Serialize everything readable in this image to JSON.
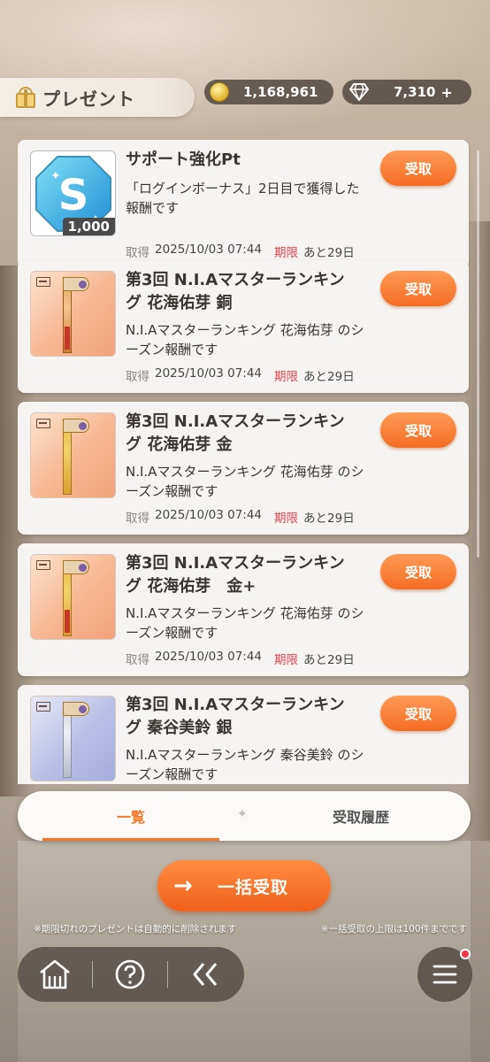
{
  "header": {
    "title": "プレゼント",
    "coins": "1,168,961",
    "gems": "7,310",
    "gems_plus": "+"
  },
  "items": [
    {
      "title": "サポート強化Pt",
      "desc": "「ログインボーナス」2日目で獲得した報酬です",
      "qty": "1,000",
      "acquired_label": "取得",
      "acquired": "2025/10/03 07:44",
      "limit_label": "期限",
      "remaining": "あと29日",
      "button": "受取",
      "thumb": "support-pt"
    },
    {
      "title": "第3回 N.I.Aマスターランキング 花海佑芽 銅",
      "desc": "N.I.Aマスターランキング 花海佑芽 のシーズン報酬です",
      "acquired_label": "取得",
      "acquired": "2025/10/03 07:44",
      "limit_label": "期限",
      "remaining": "あと29日",
      "button": "受取",
      "thumb": "banner-copper"
    },
    {
      "title": "第3回 N.I.Aマスターランキング 花海佑芽 金",
      "desc": "N.I.Aマスターランキング 花海佑芽 のシーズン報酬です",
      "acquired_label": "取得",
      "acquired": "2025/10/03 07:44",
      "limit_label": "期限",
      "remaining": "あと29日",
      "button": "受取",
      "thumb": "banner-gold"
    },
    {
      "title": "第3回 N.I.Aマスターランキング 花海佑芽　金+",
      "desc": "N.I.Aマスターランキング 花海佑芽 のシーズン報酬です",
      "acquired_label": "取得",
      "acquired": "2025/10/03 07:44",
      "limit_label": "期限",
      "remaining": "あと29日",
      "button": "受取",
      "thumb": "banner-gold-plus"
    },
    {
      "title": "第3回 N.I.Aマスターランキング 秦谷美鈴 銀",
      "desc": "N.I.Aマスターランキング 秦谷美鈴 のシーズン報酬です",
      "button": "受取",
      "thumb": "banner-silver"
    }
  ],
  "tabs": {
    "list": "一覧",
    "history": "受取履歴"
  },
  "bulk_button": "一括受取",
  "notes": {
    "left": "※期限切れのプレゼントは自動的に削除されます",
    "right": "※一括受取の上限は100件までです"
  }
}
